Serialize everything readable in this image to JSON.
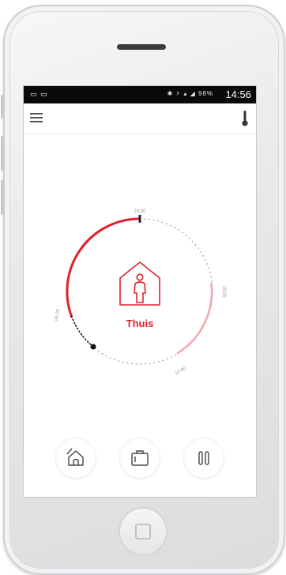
{
  "statusbar": {
    "left_text": "▭ ▭",
    "icons_text": "✱ ⚡ ▴ ◢ 98%",
    "time": "14:56"
  },
  "schedule": {
    "mode_label": "Thuis",
    "times": [
      "24:00",
      "18:00",
      "12:00",
      "06:00"
    ]
  },
  "colors": {
    "accent": "#e1202f",
    "accent_light": "#f2a6ad",
    "dots": "#8a8a8a"
  },
  "icons": {
    "menu": "hamburger-icon",
    "thermometer": "thermometer-icon",
    "home_mode": "house-person-icon",
    "away": "house-away-icon",
    "travel": "suitcase-icon",
    "pause": "pause-icon"
  }
}
